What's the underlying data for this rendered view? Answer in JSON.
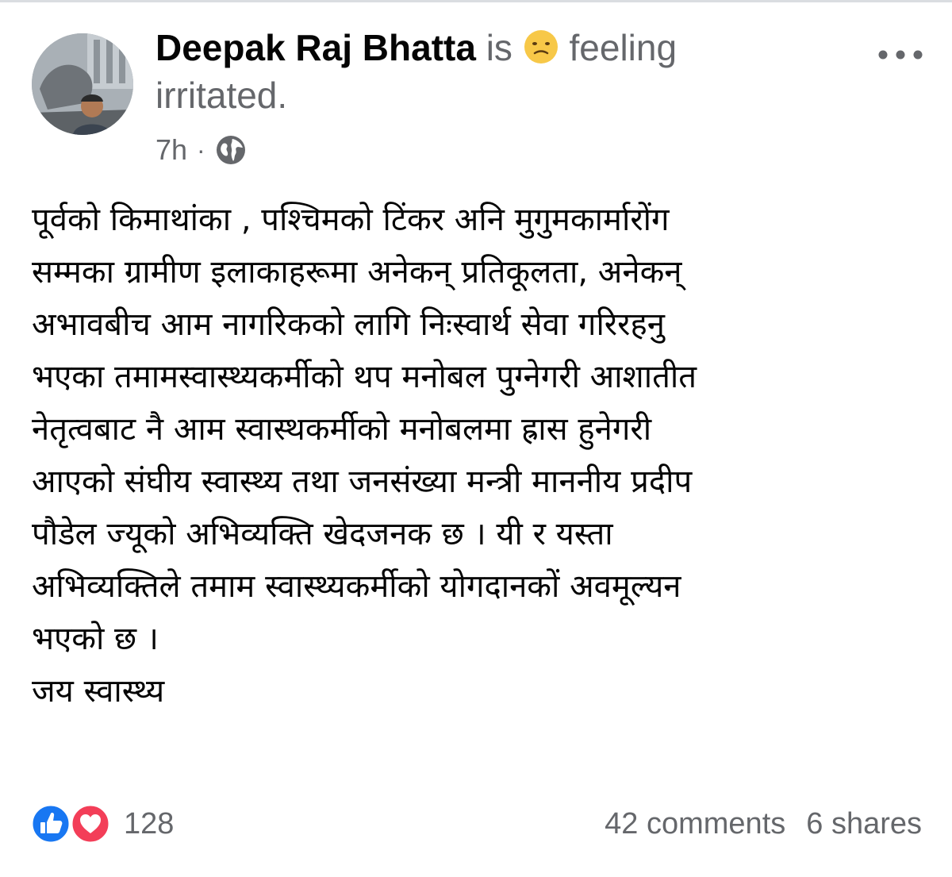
{
  "post": {
    "author": "Deepak Raj Bhatta",
    "is_word": "is",
    "feeling_prefix": "feeling",
    "feeling": "irritated.",
    "feeling_emoji": "irritated-face-emoji",
    "timestamp": "7h",
    "separator": "·",
    "audience_icon": "globe-icon",
    "body_lines": [
      "पूर्वको किमाथांका , पश्चिमको टिंकर अनि मुगुमकार्मारोंग",
      "सम्मका ग्रामीण इलाकाहरूमा अनेकन् प्रतिकूलता, अनेकन्",
      "अभावबीच आम नागरिकको लागि निःस्वार्थ सेवा गरिरहनु",
      "भएका तमामस्वास्थ्यकर्मीको थप मनोबल पुग्नेगरी आशातीत",
      "नेतृत्वबाट नै आम स्वास्थकर्मीको मनोबलमा ह्रास हुनेगरी",
      "आएको संघीय स्वास्थ्य तथा जनसंख्या मन्त्री माननीय प्रदीप",
      "पौडेल ज्यूको अभिव्यक्ति खेदजनक छ । यी र यस्ता",
      "अभिव्यक्तिले तमाम स्वास्थ्यकर्मीको योगदानकों अवमूल्यन",
      "भएको छ ।",
      "जय स्वास्थ्य"
    ]
  },
  "footer": {
    "reaction_icons": [
      "like-icon",
      "love-icon"
    ],
    "reaction_count": "128",
    "comments": "42 comments",
    "shares": "6 shares"
  },
  "colors": {
    "text": "#050505",
    "secondary": "#65676b",
    "like": "#1877f2",
    "love": "#f33e58",
    "emoji": "#f7c848"
  }
}
